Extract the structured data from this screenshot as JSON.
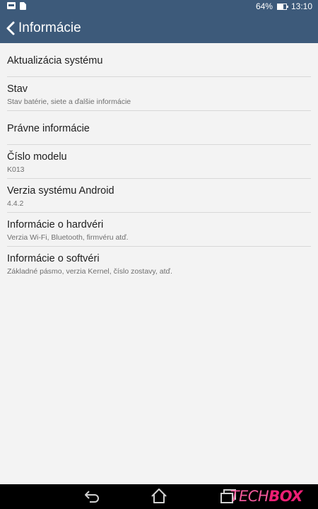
{
  "status_bar": {
    "battery_text": "64%",
    "battery_level": 0.64,
    "time": "13:10",
    "icons": [
      "image-notification-icon",
      "document-notification-icon",
      "battery-icon"
    ]
  },
  "header": {
    "title": "Informácie",
    "back_icon": "chevron-left-icon"
  },
  "list": {
    "items": [
      {
        "title": "Aktualizácia systému",
        "subtitle": ""
      },
      {
        "title": "Stav",
        "subtitle": "Stav batérie, siete a ďalšie informácie"
      },
      {
        "title": "Právne informácie",
        "subtitle": ""
      },
      {
        "title": "Číslo modelu",
        "subtitle": "K013"
      },
      {
        "title": "Verzia systému Android",
        "subtitle": "4.4.2"
      },
      {
        "title": "Informácie o hardvéri",
        "subtitle": "Verzia Wi-Fi, Bluetooth, firmvéru atď."
      },
      {
        "title": "Informácie o softvéri",
        "subtitle": "Základné pásmo, verzia Kernel, číslo zostavy, atď."
      }
    ]
  },
  "nav_bar": {
    "icons": [
      "back-icon",
      "home-icon",
      "recent-apps-icon"
    ]
  },
  "watermark": {
    "text_a": "TECH",
    "text_b": "BOX"
  },
  "colors": {
    "action_bar": "#3d5a7a",
    "background": "#f3f3f3",
    "divider": "#d8d8d8",
    "watermark": "#ec1f74"
  }
}
